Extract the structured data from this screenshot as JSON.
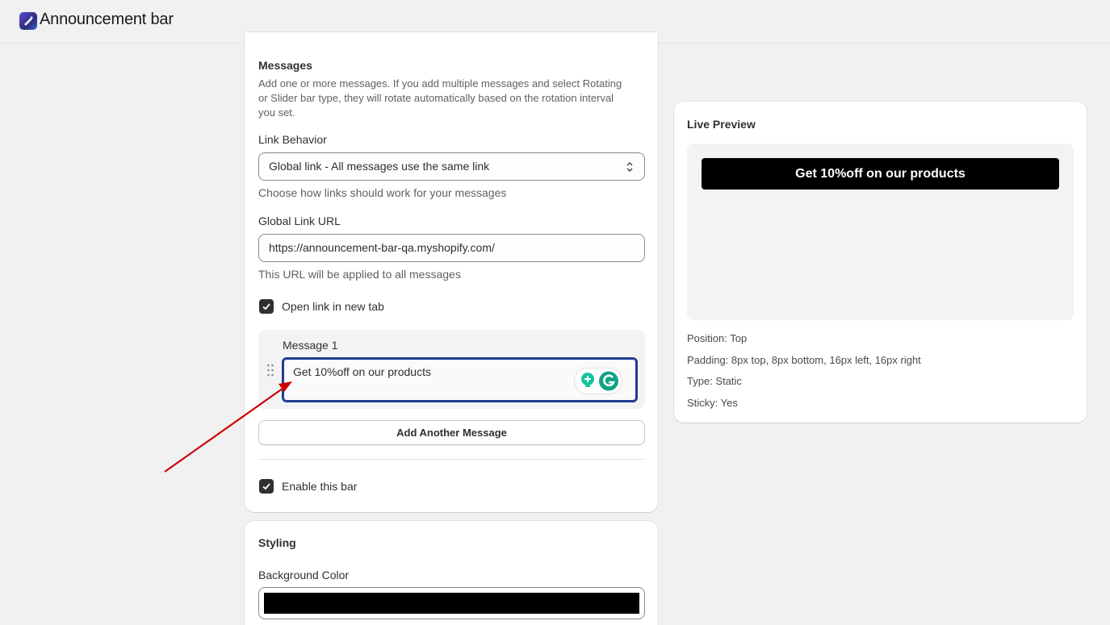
{
  "app": {
    "title": "Announcement bar",
    "icon": "app-logo-icon"
  },
  "messages": {
    "title": "Messages",
    "help": "Add one or more messages. If you add multiple messages and select Rotating or Slider bar type, they will rotate automatically based on the rotation interval you set.",
    "link_behavior": {
      "label": "Link Behavior",
      "value": "Global link - All messages use the same link",
      "help": "Choose how links should work for your messages"
    },
    "global_url": {
      "label": "Global Link URL",
      "value": "https://announcement-bar-qa.myshopify.com/",
      "help": "This URL will be applied to all messages"
    },
    "open_new_tab": {
      "label": "Open link in new tab",
      "checked": true
    },
    "items": [
      {
        "label": "Message 1",
        "value": "Get 10%off on our products"
      }
    ],
    "add_button": "Add Another Message",
    "enable_bar": {
      "label": "Enable this bar",
      "checked": true
    }
  },
  "styling": {
    "title": "Styling",
    "background_color": {
      "label": "Background Color",
      "value": "#000000"
    }
  },
  "preview": {
    "title": "Live Preview",
    "bar_text": "Get 10%off on our products",
    "position": "Position: Top",
    "padding": "Padding: 8px top, 8px bottom, 16px left, 16px right",
    "type": "Type: Static",
    "sticky": "Sticky: Yes"
  },
  "colors": {
    "accent": "#1f3b8f",
    "bar": "#000000",
    "arrow": "#cc0000",
    "grammarly": "#15c39a"
  }
}
